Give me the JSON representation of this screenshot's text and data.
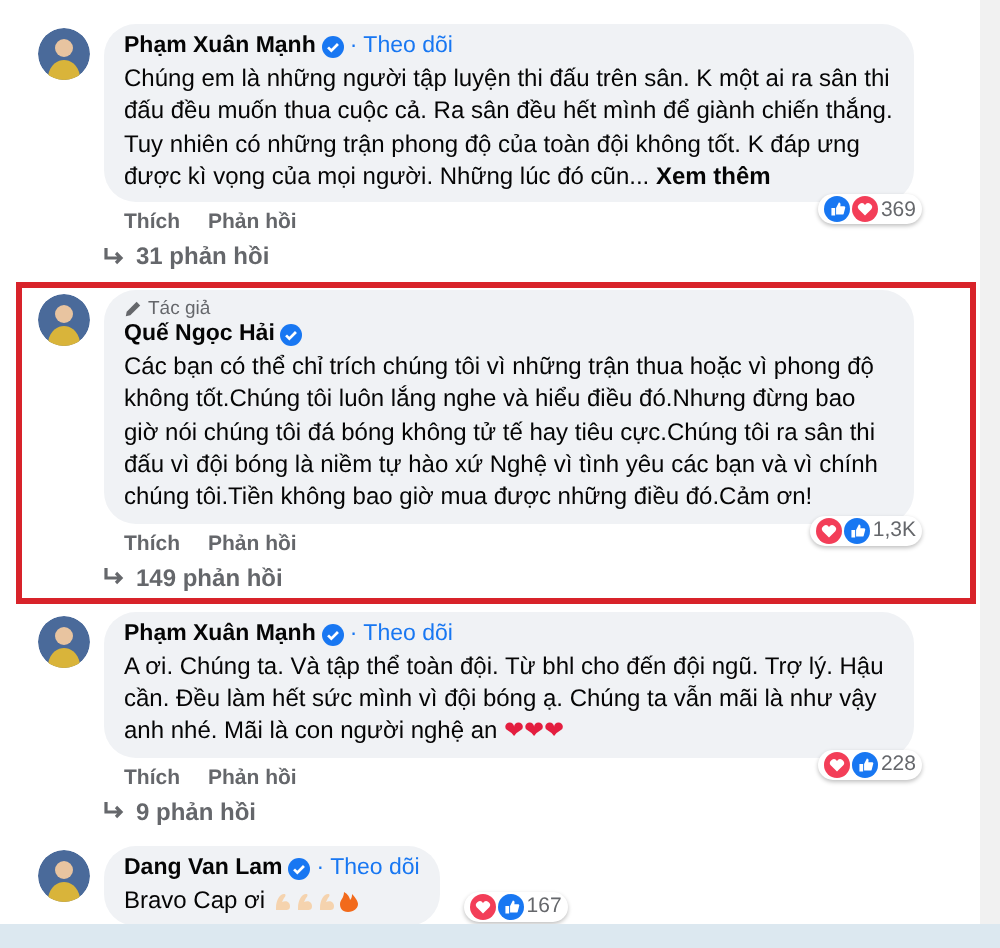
{
  "comments": [
    {
      "author": "Phạm Xuân Mạnh",
      "verified": true,
      "follow": "· Theo dõi",
      "text": "Chúng em là những người tập luyện thi đấu trên sân. K một ai ra sân thi đấu đều muốn thua cuộc cả. Ra sân đều hết mình để giành chiến thắng. Tuy nhiên có những trận phong độ của toàn đội không tốt. K đáp ưng được kì vọng của mọi người. Những lúc đó cũn...",
      "see_more": "Xem thêm",
      "reactions": [
        {
          "kind": "like"
        },
        {
          "kind": "love"
        }
      ],
      "reaction_count": "369",
      "actions": [
        "Thích",
        "Phản hồi"
      ],
      "replies": "31 phản hồi",
      "highlighted": false
    },
    {
      "author_badge": "Tác giả",
      "author": "Quế Ngọc Hải",
      "verified": true,
      "text": "Các bạn có thể chỉ trích chúng tôi vì những trận thua hoặc vì phong độ không tốt.Chúng tôi luôn lắng nghe và hiểu điều đó.Nhưng đừng bao giờ nói chúng tôi đá bóng không tử tế hay tiêu cực.Chúng tôi ra sân thi đấu vì đội bóng là niềm tự hào xứ Nghệ vì tình yêu các bạn và vì chính chúng tôi.Tiền không bao giờ mua được những điều đó.Cảm ơn!",
      "reactions": [
        {
          "kind": "love"
        },
        {
          "kind": "like"
        }
      ],
      "reaction_count": "1,3K",
      "actions": [
        "Thích",
        "Phản hồi"
      ],
      "replies": "149 phản hồi",
      "highlighted": true
    },
    {
      "author": "Phạm Xuân Mạnh",
      "verified": true,
      "follow": "· Theo dõi",
      "text": "A ơi. Chúng ta. Và tập thể toàn đội. Từ bhl cho đến đội ngũ. Trợ lý. Hậu cần. Đều làm hết sức mình vì đội bóng ạ. Chúng ta vẫn mãi là như vậy anh nhé. Mãi là con người nghệ an",
      "hearts": "❤❤❤",
      "reactions": [
        {
          "kind": "love"
        },
        {
          "kind": "like"
        }
      ],
      "reaction_count": "228",
      "actions": [
        "Thích",
        "Phản hồi"
      ],
      "replies": "9 phản hồi",
      "highlighted": false
    },
    {
      "author": "Dang Van Lam",
      "verified": true,
      "follow": "· Theo dõi",
      "text": "Bravo Cap ơi",
      "emoji": true,
      "reactions": [
        {
          "kind": "love"
        },
        {
          "kind": "like"
        }
      ],
      "reaction_count": "167",
      "highlighted": false
    }
  ]
}
